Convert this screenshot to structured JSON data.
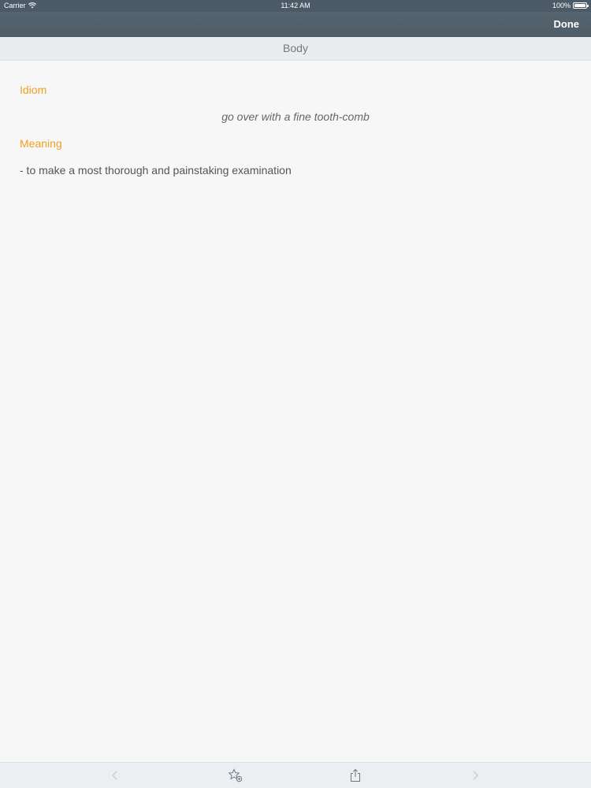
{
  "status_bar": {
    "carrier": "Carrier",
    "time": "11:42 AM",
    "battery": "100%"
  },
  "nav": {
    "done_label": "Done"
  },
  "section": {
    "title": "Body"
  },
  "entry": {
    "idiom_label": "Idiom",
    "idiom_text": "go over with a fine tooth-comb",
    "meaning_label": "Meaning",
    "meaning_text": "- to make a most thorough and painstaking examination"
  },
  "colors": {
    "accent": "#f0a020",
    "nav_bg": "#4f5d68"
  },
  "toolbar": {
    "icons": [
      "back-chevron-icon",
      "star-add-icon",
      "share-icon",
      "forward-chevron-icon"
    ]
  }
}
